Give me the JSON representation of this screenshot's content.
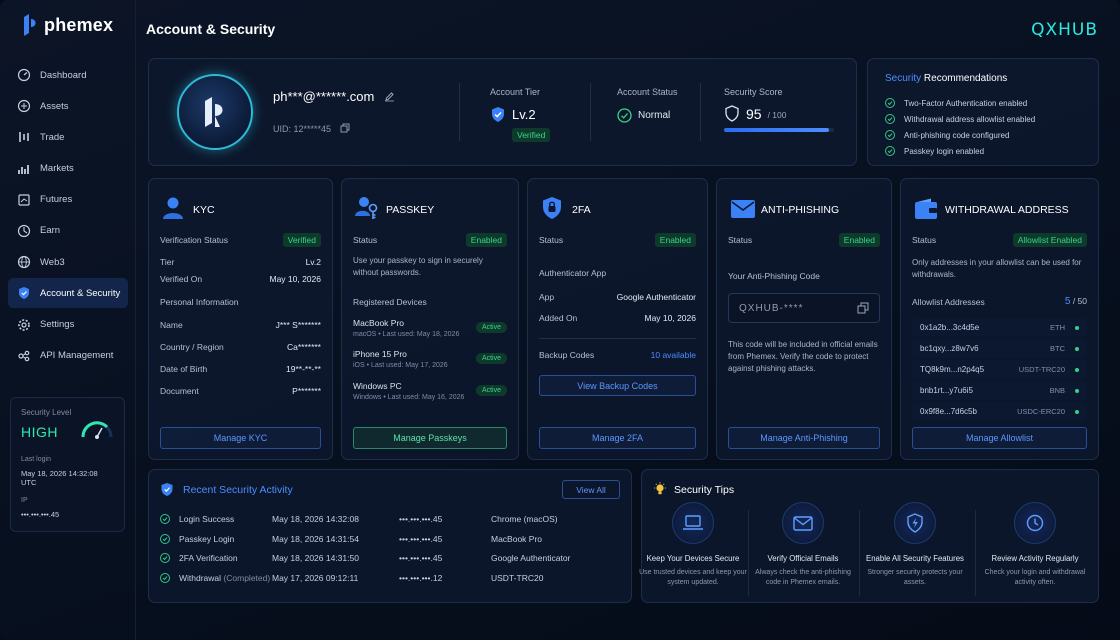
{
  "app": {
    "logo_text": "phemex",
    "page_title": "Account & Security",
    "brand": "QXHUB"
  },
  "sidebar": {
    "items": [
      {
        "label": "Dashboard",
        "icon": "dashboard-icon"
      },
      {
        "label": "Assets",
        "icon": "assets-icon"
      },
      {
        "label": "Trade",
        "icon": "trade-icon"
      },
      {
        "label": "Markets",
        "icon": "markets-icon"
      },
      {
        "label": "Futures",
        "icon": "futures-icon"
      },
      {
        "label": "Earn",
        "icon": "earn-icon"
      },
      {
        "label": "Web3",
        "icon": "web3-icon"
      },
      {
        "label": "Account & Security",
        "icon": "shield-icon",
        "active": true
      },
      {
        "label": "Settings",
        "icon": "gear-icon"
      },
      {
        "label": "API Management",
        "icon": "api-icon"
      }
    ],
    "security_level": {
      "label": "Security Level",
      "value": "HIGH",
      "last_login_label": "Last login",
      "last_login": "May 18, 2026 14:32:08 UTC",
      "ip_label": "IP",
      "ip": "•••.•••.•••.45"
    }
  },
  "profile": {
    "email": "ph***@******.com",
    "uid": "UID: 12*****45",
    "tier_label": "Account Tier",
    "tier": "Lv.2",
    "tier_badge": "Verified",
    "status_label": "Account Status",
    "status": "Normal",
    "score_label": "Security Score",
    "score": "95",
    "score_max": "/ 100",
    "score_fraction": 0.95
  },
  "recommendations": {
    "title_a": "Security",
    "title_b": "Recommendations",
    "items": [
      "Two-Factor Authentication enabled",
      "Withdrawal address allowlist enabled",
      "Anti-phishing code configured",
      "Passkey login enabled"
    ]
  },
  "kyc": {
    "title": "KYC",
    "status_label": "Verification Status",
    "status": "Verified",
    "tier_label": "Tier",
    "tier": "Lv.2",
    "verified_label": "Verified On",
    "verified_on": "May 10, 2026",
    "personal_label": "Personal Information",
    "fields": [
      {
        "k": "Name",
        "v": "J*** S*******"
      },
      {
        "k": "Country / Region",
        "v": "Ca*******"
      },
      {
        "k": "Date of Birth",
        "v": "19**-**-**"
      },
      {
        "k": "Document",
        "v": "P*******"
      }
    ],
    "button": "Manage KYC"
  },
  "passkey": {
    "title": "PASSKEY",
    "status_label": "Status",
    "status": "Enabled",
    "desc": "Use your passkey to sign in securely without passwords.",
    "devices_label": "Registered Devices",
    "devices": [
      {
        "name": "MacBook Pro",
        "meta": "macOS • Last used: May 18, 2026",
        "state": "Active"
      },
      {
        "name": "iPhone 15 Pro",
        "meta": "iOS • Last used: May 17, 2026",
        "state": "Active"
      },
      {
        "name": "Windows PC",
        "meta": "Windows • Last used: May 16, 2026",
        "state": "Active"
      }
    ],
    "button": "Manage Passkeys"
  },
  "twofa": {
    "title": "2FA",
    "status_label": "Status",
    "status": "Enabled",
    "auth_label": "Authenticator App",
    "app_label": "App",
    "app": "Google Authenticator",
    "added_label": "Added On",
    "added": "May 10, 2026",
    "backup_label": "Backup Codes",
    "backup": "10 available",
    "view_button": "View Backup Codes",
    "button": "Manage 2FA"
  },
  "antiphishing": {
    "title": "ANTI-PHISHING",
    "status_label": "Status",
    "status": "Enabled",
    "code_label": "Your Anti-Phishing Code",
    "code": "QXHUB-****",
    "desc": "This code will be included in official emails from Phemex. Verify the code to protect against phishing attacks.",
    "button": "Manage Anti-Phishing"
  },
  "withdrawal": {
    "title": "WITHDRAWAL ADDRESS",
    "status_label": "Status",
    "status": "Allowlist Enabled",
    "desc": "Only addresses in your allowlist can be used for withdrawals.",
    "list_label": "Allowlist Addresses",
    "count": "5",
    "max": "/ 50",
    "addresses": [
      {
        "addr": "0x1a2b...3c4d5e",
        "net": "ETH"
      },
      {
        "addr": "bc1qxy...z8w7v6",
        "net": "BTC"
      },
      {
        "addr": "TQ8k9m...n2p4q5",
        "net": "USDT-TRC20"
      },
      {
        "addr": "bnb1rt...y7u6i5",
        "net": "BNB"
      },
      {
        "addr": "0x9f8e...7d6c5b",
        "net": "USDC-ERC20"
      }
    ],
    "button": "Manage Allowlist"
  },
  "activity": {
    "title": "Recent Security Activity",
    "view_all": "View All",
    "rows": [
      {
        "event": "Login Success",
        "extra": "",
        "time": "May 18, 2026 14:32:08",
        "ip": "•••.•••.•••.45",
        "device": "Chrome (macOS)"
      },
      {
        "event": "Passkey Login",
        "extra": "",
        "time": "May 18, 2026 14:31:54",
        "ip": "•••.•••.•••.45",
        "device": "MacBook Pro"
      },
      {
        "event": "2FA Verification",
        "extra": "",
        "time": "May 18, 2026 14:31:50",
        "ip": "•••.•••.•••.45",
        "device": "Google Authenticator"
      },
      {
        "event": "Withdrawal",
        "extra": "(Completed)",
        "time": "May 17, 2026 09:12:11",
        "ip": "•••.•••.•••.12",
        "device": "USDT-TRC20"
      }
    ]
  },
  "tips": {
    "title": "Security Tips",
    "items": [
      {
        "title": "Keep Your Devices Secure",
        "desc": "Use trusted devices and keep your system updated."
      },
      {
        "title": "Verify Official Emails",
        "desc": "Always check the anti-phishing code in Phemex emails."
      },
      {
        "title": "Enable All Security Features",
        "desc": "Stronger security protects your assets."
      },
      {
        "title": "Review Activity Regularly",
        "desc": "Check your login and withdrawal activity often."
      }
    ]
  },
  "colors": {
    "accent": "#4c8dff",
    "success": "#37d58a",
    "teal": "#2ee8e0",
    "background": "#07101f"
  }
}
